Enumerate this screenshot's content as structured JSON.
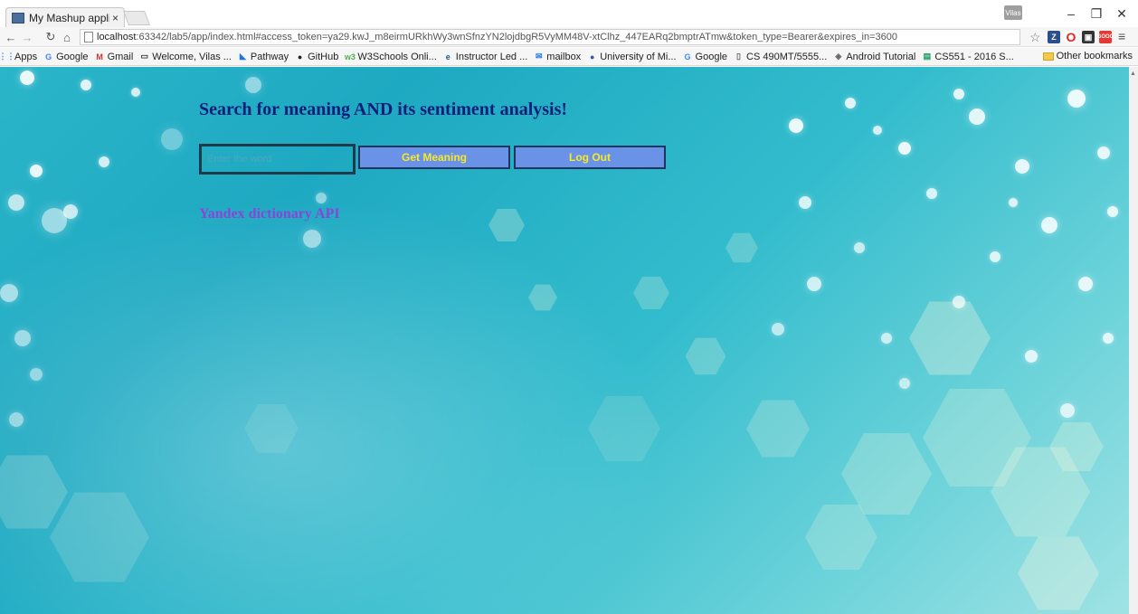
{
  "tab": {
    "title": "My Mashup applicati",
    "close": "×"
  },
  "window": {
    "profile": "Vilas",
    "minimize": "–",
    "maximize": "❐",
    "close": "✕"
  },
  "toolbar": {
    "url_host": "localhost",
    "url_rest": ":63342/lab5/app/index.html#access_token=ya29.kwJ_m8eirmURkhWy3wnSfnzYN2lojdbgR5VyMM48V-xtClhz_447EARq2bmptrATmw&token_type=Bearer&expires_in=3600"
  },
  "bookmarks": [
    {
      "label": "Apps",
      "icon": "apps-icon",
      "color": "#4285f4",
      "glyph": "⋮⋮"
    },
    {
      "label": "Google",
      "icon": "google-icon",
      "color": "#4285f4",
      "glyph": "G"
    },
    {
      "label": "Gmail",
      "icon": "gmail-icon",
      "color": "#d93025",
      "glyph": "M"
    },
    {
      "label": "Welcome, Vilas ...",
      "icon": "mail-icon",
      "color": "#333333",
      "glyph": "▭"
    },
    {
      "label": "Pathway",
      "icon": "pathway-icon",
      "color": "#1a73e8",
      "glyph": "◣"
    },
    {
      "label": "GitHub",
      "icon": "github-icon",
      "color": "#222222",
      "glyph": "●"
    },
    {
      "label": "W3Schools Onli...",
      "icon": "w3schools-icon",
      "color": "#4caf50",
      "glyph": "w3"
    },
    {
      "label": "Instructor Led ...",
      "icon": "edx-icon",
      "color": "#0a5e9c",
      "glyph": "e"
    },
    {
      "label": "mailbox",
      "icon": "mailbox-icon",
      "color": "#1a73e8",
      "glyph": "✉"
    },
    {
      "label": "University of Mi...",
      "icon": "university-icon",
      "color": "#2a5db0",
      "glyph": "●"
    },
    {
      "label": "Google",
      "icon": "google-icon",
      "color": "#4285f4",
      "glyph": "G"
    },
    {
      "label": "CS 490MT/5555...",
      "icon": "page-icon",
      "color": "#666666",
      "glyph": "▯"
    },
    {
      "label": "Android Tutorial",
      "icon": "android-icon",
      "color": "#666666",
      "glyph": "◈"
    },
    {
      "label": "CS551 - 2016 S...",
      "icon": "sheet-icon",
      "color": "#0f9d58",
      "glyph": "▤"
    }
  ],
  "other_bookmarks": "Other bookmarks",
  "app": {
    "heading": "Search for meaning AND its sentiment analysis!",
    "input_placeholder": "Enter the word",
    "get_meaning_label": "Get Meaning",
    "logout_label": "Log Out",
    "api_label": "Yandex dictionary API"
  }
}
